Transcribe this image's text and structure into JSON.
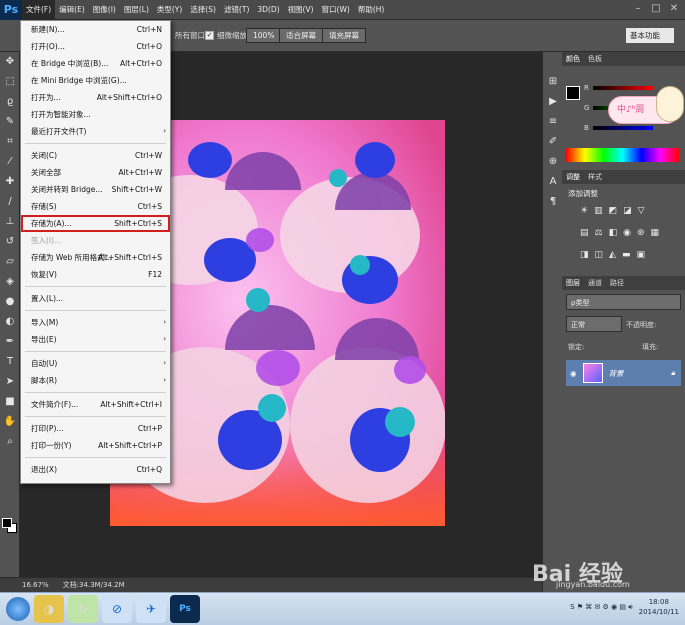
{
  "menubar": {
    "logo": "Ps",
    "items": [
      "文件(F)",
      "编辑(E)",
      "图像(I)",
      "图层(L)",
      "类型(Y)",
      "选择(S)",
      "滤镜(T)",
      "3D(D)",
      "视图(V)",
      "窗口(W)",
      "帮助(H)"
    ]
  },
  "optionsbar": {
    "all_windows_label": "所有窗口",
    "scrubby_zoom_label": "细微缩放",
    "zoom_100": "100%",
    "fit_screen": "适合屏幕",
    "fill_screen": "填充屏幕",
    "workspace": "基本功能"
  },
  "file_menu": {
    "items": [
      {
        "label": "新建(N)...",
        "shortcut": "Ctrl+N"
      },
      {
        "label": "打开(O)...",
        "shortcut": "Ctrl+O"
      },
      {
        "label": "在 Bridge 中浏览(B)...",
        "shortcut": "Alt+Ctrl+O"
      },
      {
        "label": "在 Mini Bridge 中浏览(G)...",
        "shortcut": ""
      },
      {
        "label": "打开为...",
        "shortcut": "Alt+Shift+Ctrl+O"
      },
      {
        "label": "打开为智能对象...",
        "shortcut": ""
      },
      {
        "label": "最近打开文件(T)",
        "shortcut": ""
      },
      {
        "label": "关闭(C)",
        "shortcut": "Ctrl+W"
      },
      {
        "label": "关闭全部",
        "shortcut": "Alt+Ctrl+W"
      },
      {
        "label": "关闭并转到 Bridge...",
        "shortcut": "Shift+Ctrl+W"
      },
      {
        "label": "存储(S)",
        "shortcut": "Ctrl+S"
      },
      {
        "label": "存储为(A)...",
        "shortcut": "Shift+Ctrl+S"
      },
      {
        "label": "签入(I)...",
        "shortcut": ""
      },
      {
        "label": "存储为 Web 所用格式...",
        "shortcut": "Alt+Shift+Ctrl+S"
      },
      {
        "label": "恢复(V)",
        "shortcut": "F12"
      },
      {
        "label": "置入(L)...",
        "shortcut": ""
      },
      {
        "label": "导入(M)",
        "shortcut": ""
      },
      {
        "label": "导出(E)",
        "shortcut": ""
      },
      {
        "label": "自动(U)",
        "shortcut": ""
      },
      {
        "label": "脚本(R)",
        "shortcut": ""
      },
      {
        "label": "文件简介(F)...",
        "shortcut": "Alt+Shift+Ctrl+I"
      },
      {
        "label": "打印(P)...",
        "shortcut": "Ctrl+P"
      },
      {
        "label": "打印一份(Y)",
        "shortcut": "Alt+Shift+Ctrl+P"
      },
      {
        "label": "退出(X)",
        "shortcut": "Ctrl+Q"
      }
    ]
  },
  "status": {
    "zoom": "16.67%",
    "doc_size": "文档:34.3M/34.2M"
  },
  "panels": {
    "color_tabs": [
      "颜色",
      "色板"
    ],
    "rgb": [
      "R",
      "G",
      "B"
    ],
    "adjust_tabs": [
      "调整",
      "样式"
    ],
    "adjust_title": "添加调整",
    "layer_tabs": [
      "图层",
      "通道",
      "路径"
    ],
    "kind_label": "ρ类型",
    "blend_mode": "正常",
    "opacity_label": "不透明度:",
    "lock_label": "锁定:",
    "fill_label": "填充:",
    "layer_name": "背景",
    "avatar_text": "中♪ʰ周"
  },
  "taskbar": {
    "time": "18:08",
    "date": "2014/10/11"
  },
  "watermark": {
    "main": "Bai 经验",
    "sub": "jingyan.baidu.com"
  },
  "colors": {
    "highlight": "#d11f1f",
    "layer_selected": "#5c7fb0"
  }
}
